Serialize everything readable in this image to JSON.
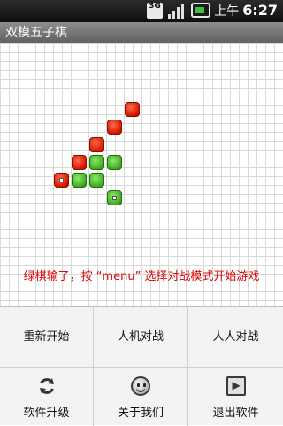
{
  "status_bar": {
    "network_label": "3G",
    "signal_icon": "signal-icon",
    "battery_icon": "battery-charging-icon",
    "ampm": "上午",
    "time": "6:27"
  },
  "app": {
    "title": "双模五子棋"
  },
  "board": {
    "message": "绿棋输了，按 “menu” 选择对战模式开始游戏"
  },
  "menu": {
    "restart": "重新开始",
    "vs_computer": "人机对战",
    "vs_human": "人人对战",
    "upgrade": "软件升级",
    "about": "关于我们",
    "exit": "退出软件",
    "upgrade_icon": "refresh-icon",
    "about_icon": "smiley-icon",
    "exit_icon": "exit-icon"
  }
}
